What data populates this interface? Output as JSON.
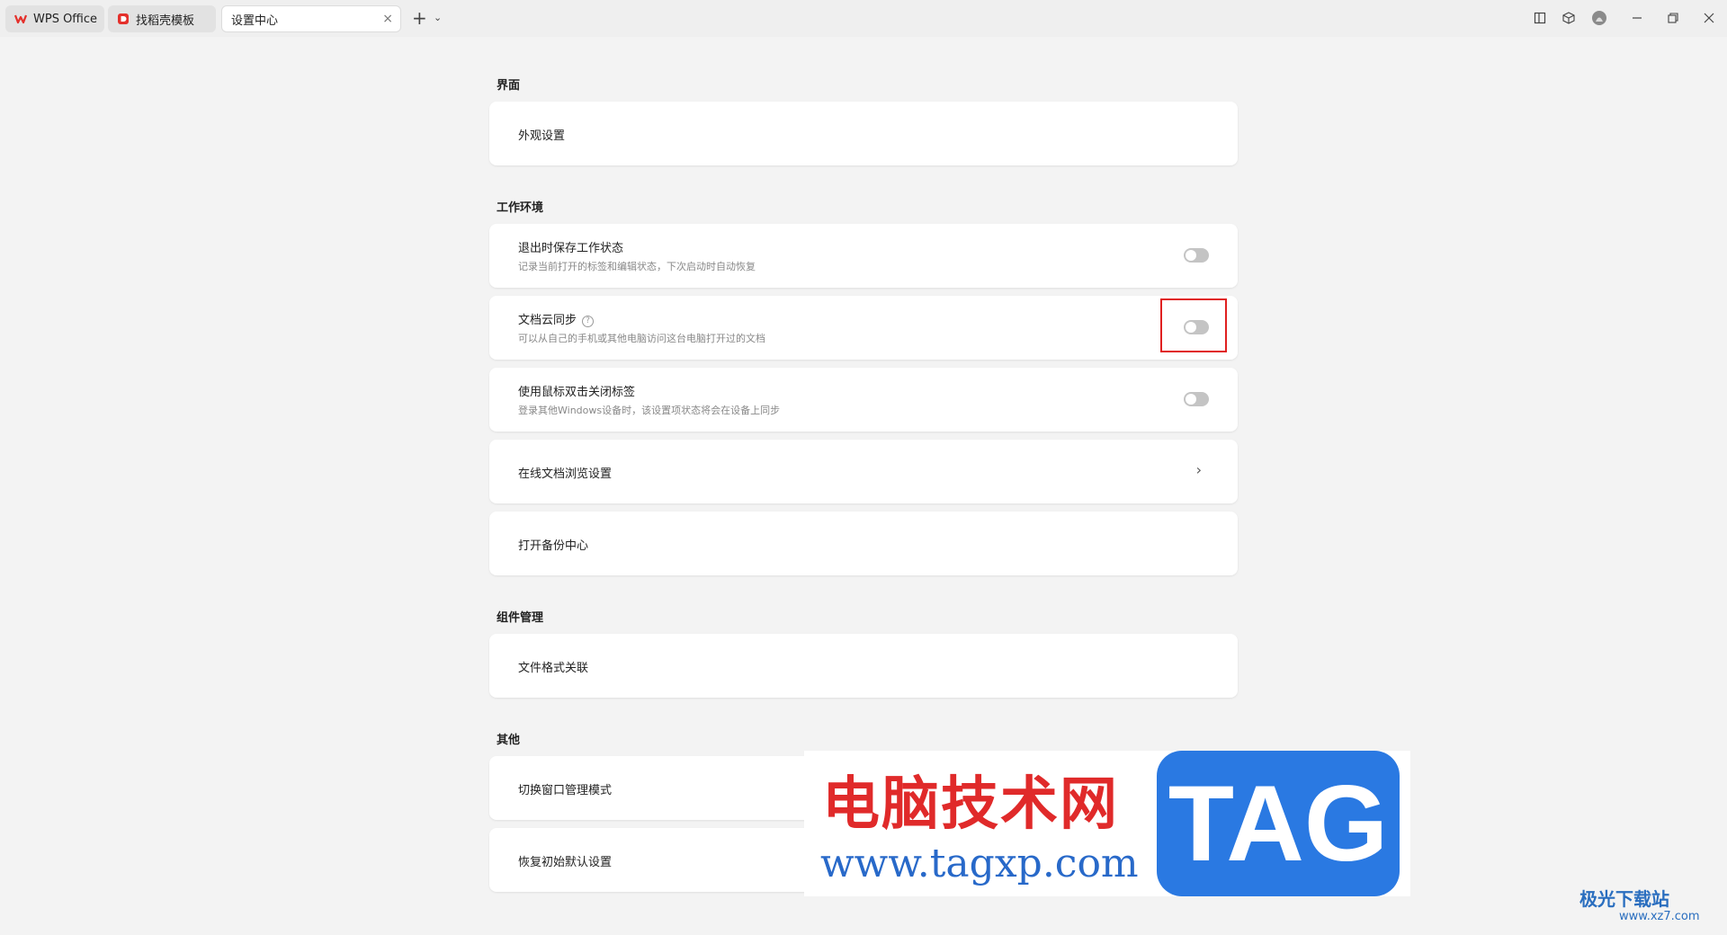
{
  "tabs": [
    {
      "label": "WPS Office",
      "icon": "wps-logo-icon",
      "color": "#e4302b"
    },
    {
      "label": "找稻壳模板",
      "icon": "docer-icon",
      "color": "#e4302b"
    },
    {
      "label": "设置中心",
      "icon": "",
      "active": true
    }
  ],
  "tabbar": {
    "new_tab": "+",
    "new_tab_menu": "⌄",
    "close": "×"
  },
  "window_controls": [
    "layout-icon",
    "cube-icon",
    "avatar",
    "minimize-icon",
    "restore-icon",
    "close-icon"
  ],
  "sections": {
    "interface": {
      "title": "界面",
      "items": {
        "appearance": "外观设置"
      }
    },
    "workspace": {
      "title": "工作环境",
      "items": {
        "save_state": {
          "title": "退出时保存工作状态",
          "desc": "记录当前打开的标签和编辑状态，下次启动时自动恢复",
          "enabled": false
        },
        "cloud_sync": {
          "title": "文档云同步",
          "desc": "可以从自己的手机或其他电脑访问这台电脑打开过的文档",
          "enabled": false,
          "help": "?"
        },
        "dblclick_close": {
          "title": "使用鼠标双击关闭标签",
          "desc": "登录其他Windows设备时，该设置项状态将会在设备上同步",
          "enabled": false
        },
        "online_browse": {
          "title": "在线文档浏览设置",
          "chevron": "›"
        },
        "backup_center": {
          "title": "打开备份中心"
        }
      }
    },
    "components": {
      "title": "组件管理",
      "items": {
        "file_assoc": "文件格式关联"
      }
    },
    "other": {
      "title": "其他",
      "items": {
        "window_mode": "切换窗口管理模式",
        "restore_defaults": "恢复初始默认设置"
      }
    }
  },
  "watermark": {
    "site_name": "电脑技术网",
    "url": "www.tagxp.com",
    "tag": "TAG",
    "corner_name": "极光下载站",
    "corner_url": "www.xz7.com"
  },
  "colors": {
    "accent_red": "#e02020",
    "toggle_off": "#c4c4c4",
    "background": "#f3f3f3"
  }
}
